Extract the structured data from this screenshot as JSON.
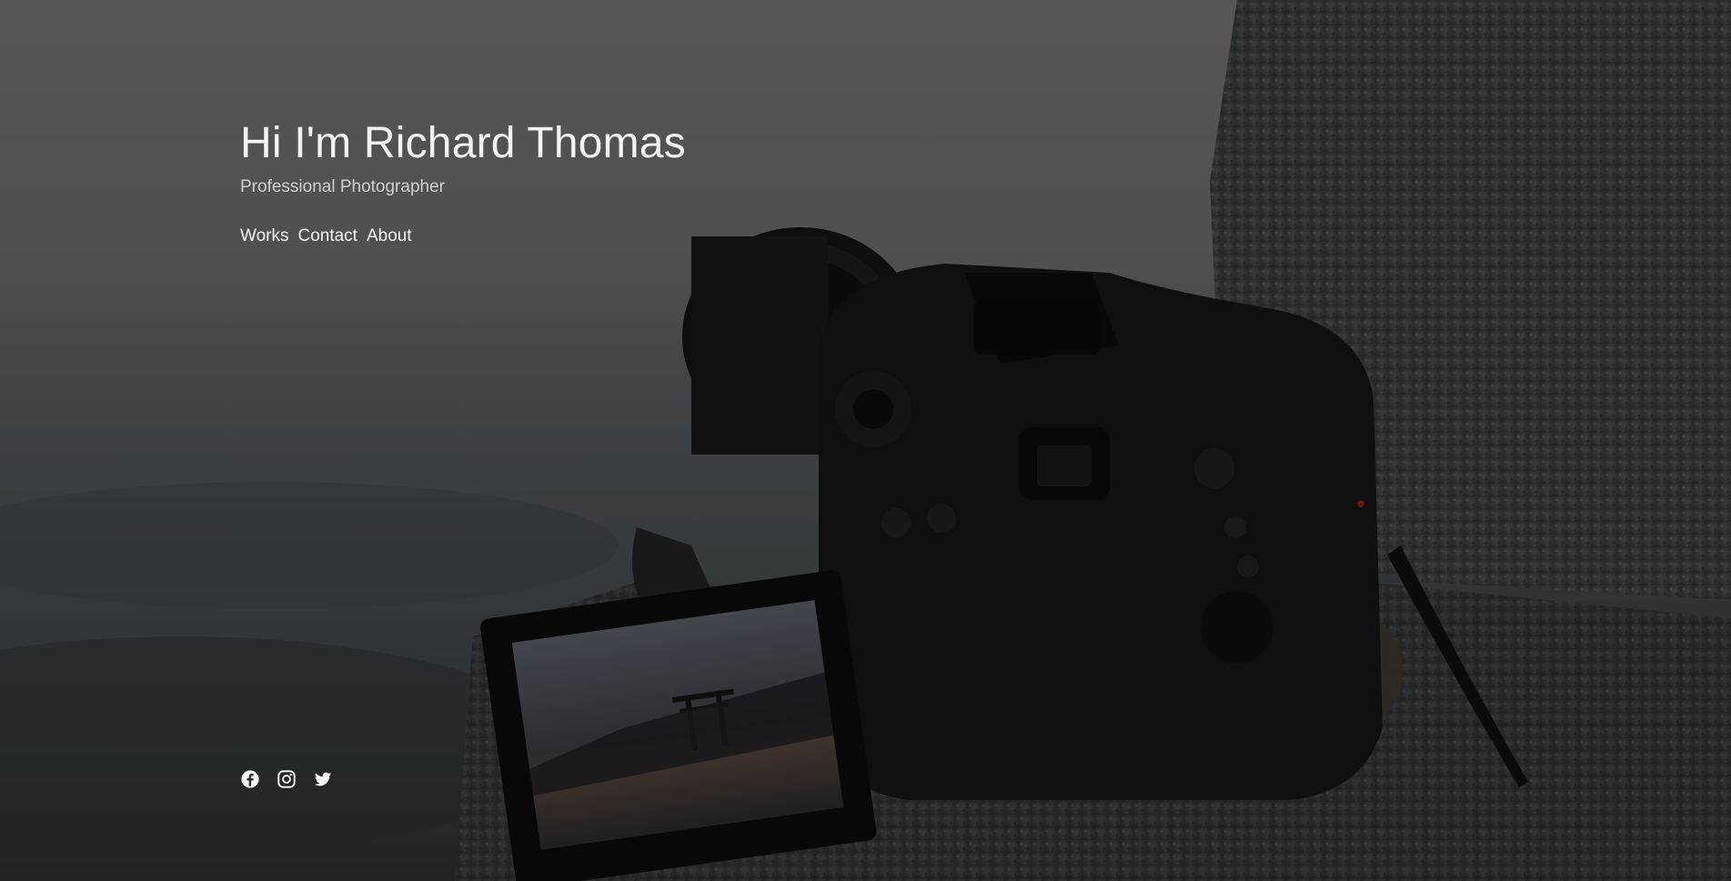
{
  "hero": {
    "title": "Hi I'm Richard Thomas",
    "subtitle": "Professional Photographer"
  },
  "nav": {
    "items": [
      {
        "label": "Works"
      },
      {
        "label": "Contact"
      },
      {
        "label": "About"
      }
    ]
  },
  "social": {
    "icons": [
      "facebook-icon",
      "instagram-icon",
      "twitter-icon"
    ]
  },
  "colors": {
    "text": "#ffffff",
    "subtitle": "#cfcfcf",
    "background_sky": "#6f6e71",
    "camera_body": "#141414",
    "rock": "#4a4a4a"
  }
}
